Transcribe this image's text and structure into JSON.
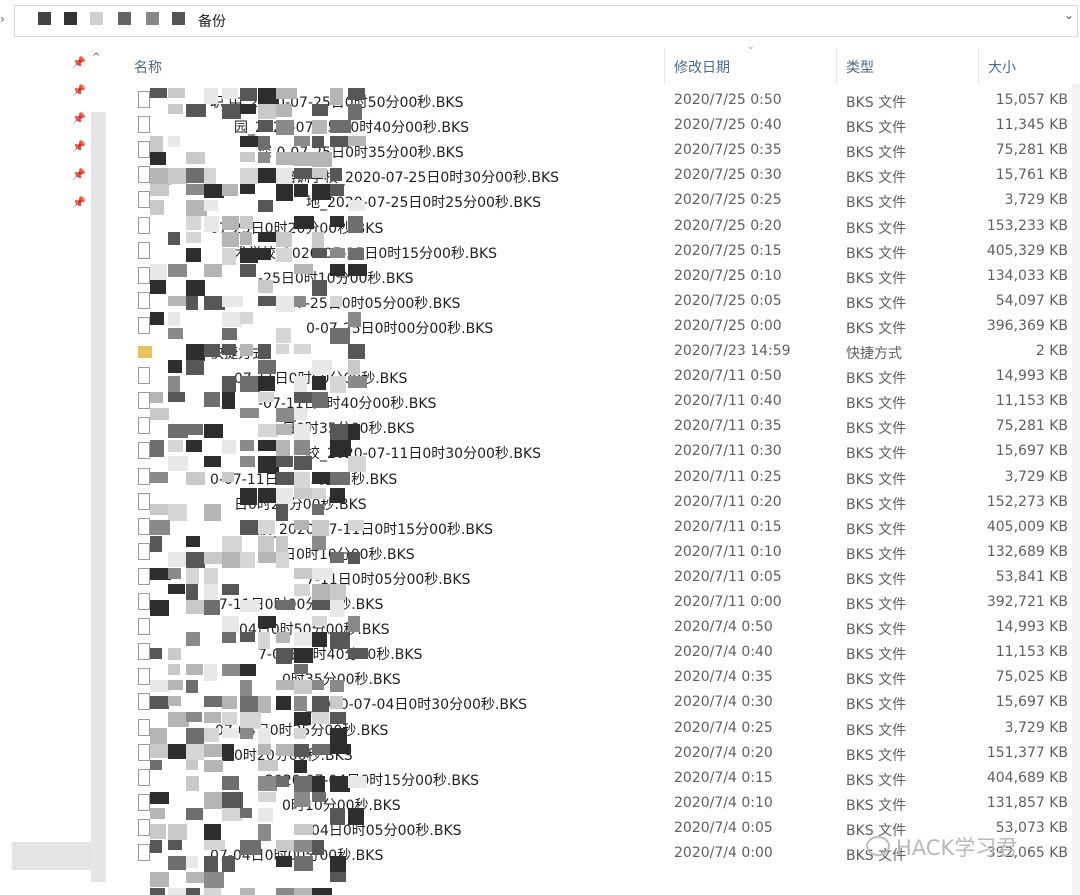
{
  "address_bar": {
    "crumb_text": "备份",
    "crumb_prefix": "亲"
  },
  "columns": {
    "name": "名称",
    "date": "修改日期",
    "type": "类型",
    "size": "大小"
  },
  "icons": {
    "pin": "pin-icon",
    "file": "file-icon",
    "shortcut": "shortcut-icon",
    "dropdown": "chevron-down-icon",
    "back": "chevron-right-icon",
    "scroll_up": "chevron-up-icon"
  },
  "files": [
    {
      "name": "职   中_2020-07-25日0时50分00秒.BKS",
      "date": "2020/7/25 0:50",
      "type": "BKS 文件",
      "size": "15,057 KB"
    },
    {
      "name": "园_2020-07-25日0时40分00秒.BKS",
      "date": "2020/7/25 0:40",
      "type": "BKS 文件",
      "size": "11,345 KB"
    },
    {
      "name": "深   0-07-25日0时35分00秒.BKS",
      "date": "2020/7/25 0:35",
      "type": "BKS 文件",
      "size": "75,281 KB"
    },
    {
      "name": "培训学校_2020-07-25日0时30分00秒.BKS",
      "date": "2020/7/25 0:30",
      "type": "BKS 文件",
      "size": "15,761 KB"
    },
    {
      "name": "地_2020-07-25日0时25分00秒.BKS",
      "date": "2020/7/25 0:25",
      "type": "BKS 文件",
      "size": "3,729 KB"
    },
    {
      "name": "07-25日0时20分00秒.BKS",
      "date": "2020/7/25 0:20",
      "type": "BKS 文件",
      "size": "153,233 KB"
    },
    {
      "name": "术学校_2020-07-25日0时15分00秒.BKS",
      "date": "2020/7/25 0:15",
      "type": "BKS 文件",
      "size": "405,329 KB"
    },
    {
      "name": "-25日0时10分00秒.BKS",
      "date": "2020/7/25 0:10",
      "type": "BKS 文件",
      "size": "134,033 KB"
    },
    {
      "name": "-07-25日0时05分00秒.BKS",
      "date": "2020/7/25 0:05",
      "type": "BKS 文件",
      "size": "54,097 KB"
    },
    {
      "name": "0-07-25日0时00分00秒.BKS",
      "date": "2020/7/25 0:00",
      "type": "BKS 文件",
      "size": "396,369 KB"
    },
    {
      "name": "快捷方式",
      "date": "2020/7/23 14:59",
      "type": "快捷方式",
      "size": "2 KB",
      "shortcut": true
    },
    {
      "name": "07-11日0时50分00秒.BKS",
      "date": "2020/7/11 0:50",
      "type": "BKS 文件",
      "size": "14,993 KB"
    },
    {
      "name": "-07-11日0时40分00秒.BKS",
      "date": "2020/7/11 0:40",
      "type": "BKS 文件",
      "size": "11,153 KB"
    },
    {
      "name": "日0时35分00秒.BKS",
      "date": "2020/7/11 0:35",
      "type": "BKS 文件",
      "size": "75,281 KB"
    },
    {
      "name": "校_2020-07-11日0时30分00秒.BKS",
      "date": "2020/7/11 0:30",
      "type": "BKS 文件",
      "size": "15,697 KB"
    },
    {
      "name": "0-07-11日0时25分00秒.BKS",
      "date": "2020/7/11 0:25",
      "type": "BKS 文件",
      "size": "3,729 KB"
    },
    {
      "name": "日0时20分00秒.BKS",
      "date": "2020/7/11 0:20",
      "type": "BKS 文件",
      "size": "152,273 KB"
    },
    {
      "name": "校_2020-07-11日0时15分00秒.BKS",
      "date": "2020/7/11 0:15",
      "type": "BKS 文件",
      "size": "405,009 KB"
    },
    {
      "name": "日0时10分00秒.BKS",
      "date": "2020/7/11 0:10",
      "type": "BKS 文件",
      "size": "132,689 KB"
    },
    {
      "name": "7-11日0时05分00秒.BKS",
      "date": "2020/7/11 0:05",
      "type": "BKS 文件",
      "size": "53,841 KB"
    },
    {
      "name": "07-11日0时00分00秒.BKS",
      "date": "2020/7/11 0:00",
      "type": "BKS 文件",
      "size": "392,721 KB"
    },
    {
      "name": "-04日0时50分00秒.BKS",
      "date": "2020/7/4 0:50",
      "type": "BKS 文件",
      "size": "14,993 KB"
    },
    {
      "name": "7-04日0时40分00秒.BKS",
      "date": "2020/7/4 0:40",
      "type": "BKS 文件",
      "size": "11,153 KB"
    },
    {
      "name": "0时35分00秒.BKS",
      "date": "2020/7/4 0:35",
      "type": "BKS 文件",
      "size": "75,025 KB"
    },
    {
      "name": "_2020-07-04日0时30分00秒.BKS",
      "date": "2020/7/4 0:30",
      "type": "BKS 文件",
      "size": "15,697 KB"
    },
    {
      "name": "-07-04日0时25分00秒.BKS",
      "date": "2020/7/4 0:25",
      "type": "BKS 文件",
      "size": "3,729 KB"
    },
    {
      "name": "0时20分00秒.BKS",
      "date": "2020/7/4 0:20",
      "type": "BKS 文件",
      "size": "151,377 KB"
    },
    {
      "name": "_2020-07-04日0时15分00秒.BKS",
      "date": "2020/7/4 0:15",
      "type": "BKS 文件",
      "size": "404,689 KB"
    },
    {
      "name": "0时10分00秒.BKS",
      "date": "2020/7/4 0:10",
      "type": "BKS 文件",
      "size": "131,857 KB"
    },
    {
      "name": "-04日0时05分00秒.BKS",
      "date": "2020/7/4 0:05",
      "type": "BKS 文件",
      "size": "53,073 KB"
    },
    {
      "name": "07-04日0时00分00秒.BKS",
      "date": "2020/7/4 0:00",
      "type": "BKS 文件",
      "size": "392,065 KB"
    }
  ],
  "watermark": {
    "text": "HACK学习君"
  }
}
